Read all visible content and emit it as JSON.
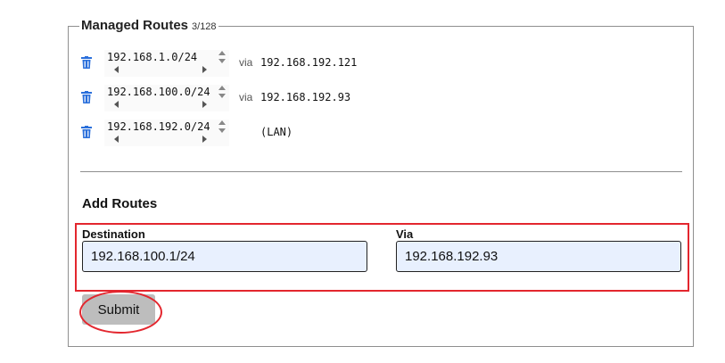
{
  "managed_routes": {
    "title": "Managed Routes",
    "count": "3/128",
    "via_label": "via",
    "routes": [
      {
        "destination": "192.168.1.0/24",
        "via": "192.168.192.121"
      },
      {
        "destination": "192.168.100.0/24",
        "via": "192.168.192.93"
      },
      {
        "destination": "192.168.192.0/24",
        "via": "(LAN)"
      }
    ]
  },
  "add_routes": {
    "title": "Add Routes",
    "destination_label": "Destination",
    "destination_value": "192.168.100.1/24",
    "via_label": "Via",
    "via_value": "192.168.192.93",
    "submit_label": "Submit"
  },
  "colors": {
    "trash_icon": "#2a6fdb",
    "highlight": "#e3262e",
    "input_bg": "#e8f0fe",
    "submit_bg": "#bdbdbd"
  }
}
